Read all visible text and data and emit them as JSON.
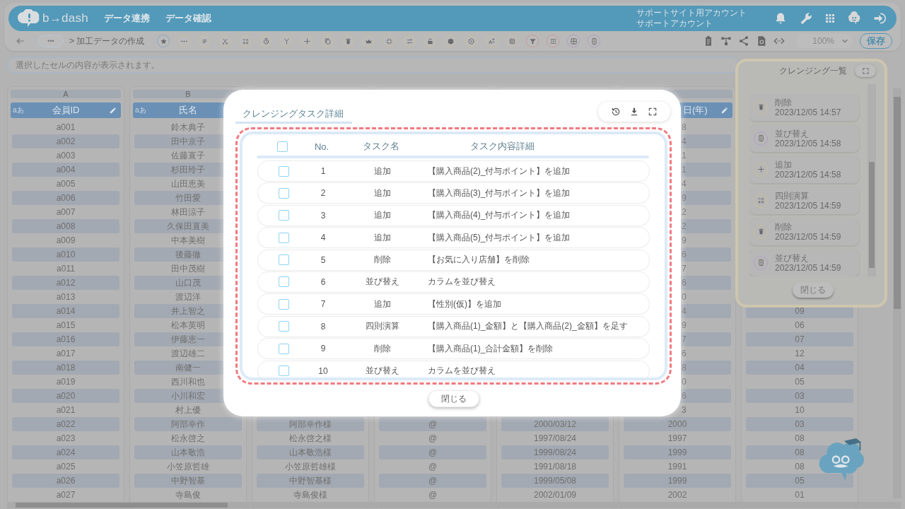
{
  "header": {
    "logo": "b→dash",
    "nav": [
      {
        "label": "データ連携"
      },
      {
        "label": "データ確認"
      }
    ],
    "account": {
      "site": "サポートサイト用アカウント",
      "name": "サポートアカウント"
    }
  },
  "toolbar": {
    "more": "•••",
    "breadcrumb": "> 加工データの作成",
    "zoom": "100%",
    "save": "保存"
  },
  "cell_field": {
    "placeholder": "選択したセルの内容が表示されます。"
  },
  "sheet": {
    "columns": [
      {
        "letter": "A",
        "header": "会員ID",
        "type_label": "aあ",
        "editable": true,
        "cells": [
          "a001",
          "a002",
          "a003",
          "a004",
          "a005",
          "a006",
          "a007",
          "a008",
          "a009",
          "a010",
          "a011",
          "a012",
          "a013",
          "a014",
          "a015",
          "a016",
          "a017",
          "a018",
          "a019",
          "a020",
          "a021",
          "a022",
          "a023",
          "a024",
          "a025",
          "a026",
          "a027"
        ]
      },
      {
        "letter": "B",
        "header": "氏名",
        "type_label": "aあ",
        "cells": [
          "鈴木典子",
          "田中京子",
          "佐藤直子",
          "杉田玲子",
          "山田恵美",
          "竹田愛",
          "林田涼子",
          "久保田直美",
          "中本美樹",
          "後藤徹",
          "田中茂樹",
          "山口茂",
          "渡辺洋",
          "井上智之",
          "松本英明",
          "伊藤恵一",
          "渡辺雄二",
          "南健一",
          "西川和也",
          "小川和宏",
          "村上優",
          "阿部幸作",
          "松永啓之",
          "山本敬浩",
          "小笠原哲雄",
          "中野智基",
          "寺島俊"
        ]
      },
      {
        "cells": [
          "阿部幸作様",
          "松永啓之様",
          "山本敬浩様",
          "小笠原哲雄様",
          "中野智基様",
          "寺島俊様"
        ]
      },
      {
        "cells": [
          "@",
          "@",
          "@",
          "@",
          "@",
          "@"
        ]
      },
      {
        "cells": [
          "2000/03/12",
          "1997/08/24",
          "1999/08/24",
          "1991/08/18",
          "1999/05/08",
          "2002/01/09"
        ]
      },
      {
        "header": "日(年)",
        "editable": true,
        "cells": [
          "8",
          "4",
          "1",
          "1",
          "4",
          "9",
          "2",
          "2",
          "9",
          "6",
          "7",
          "6",
          "0",
          "4",
          "9",
          "7",
          "6",
          "8",
          "0",
          "6",
          "3",
          "2000",
          "1997",
          "1999",
          "1991",
          "1999",
          "2002"
        ]
      },
      {
        "cells": [
          "09",
          "06",
          "07",
          "12",
          "04",
          "05",
          "03",
          "10",
          "03",
          "08",
          "08",
          "08",
          "05",
          "01"
        ]
      }
    ]
  },
  "modal": {
    "title": "クレンジングタスク詳細",
    "columns": [
      "No.",
      "タスク名",
      "タスク内容詳細"
    ],
    "all_checked": false,
    "tasks": [
      {
        "no": "1",
        "name": "追加",
        "detail": "【購入商品(2)_付与ポイント】を追加",
        "checked": false
      },
      {
        "no": "2",
        "name": "追加",
        "detail": "【購入商品(3)_付与ポイント】を追加",
        "checked": false
      },
      {
        "no": "3",
        "name": "追加",
        "detail": "【購入商品(4)_付与ポイント】を追加",
        "checked": false
      },
      {
        "no": "4",
        "name": "追加",
        "detail": "【購入商品(5)_付与ポイント】を追加",
        "checked": false
      },
      {
        "no": "5",
        "name": "削除",
        "detail": "【お気に入り店舗】を削除",
        "checked": false
      },
      {
        "no": "6",
        "name": "並び替え",
        "detail": "カラムを並び替え",
        "checked": false
      },
      {
        "no": "7",
        "name": "追加",
        "detail": "【性別(仮)】を追加",
        "checked": false
      },
      {
        "no": "8",
        "name": "四則演算",
        "detail": "【購入商品(1)_金額】と【購入商品(2)_金額】を足す",
        "checked": false
      },
      {
        "no": "9",
        "name": "削除",
        "detail": "【購入商品(1)_合計金額】を削除",
        "checked": false
      },
      {
        "no": "10",
        "name": "並び替え",
        "detail": "カラムを並び替え",
        "checked": false
      }
    ],
    "close": "閉じる"
  },
  "history_panel": {
    "title": "クレンジング一覧",
    "items": [
      {
        "kind": "delete",
        "name": "削除",
        "time": "2023/12/05 14:57"
      },
      {
        "kind": "sort",
        "name": "並び替え",
        "time": "2023/12/05 14:58"
      },
      {
        "kind": "add",
        "name": "追加",
        "time": "2023/12/05 14:58"
      },
      {
        "kind": "arithmetic",
        "name": "四則演算",
        "time": "2023/12/05 14:59"
      },
      {
        "kind": "delete",
        "name": "削除",
        "time": "2023/12/05 14:59"
      },
      {
        "kind": "sort",
        "name": "並び替え",
        "time": "2023/12/05 14:59"
      }
    ],
    "close": "閉じる"
  }
}
